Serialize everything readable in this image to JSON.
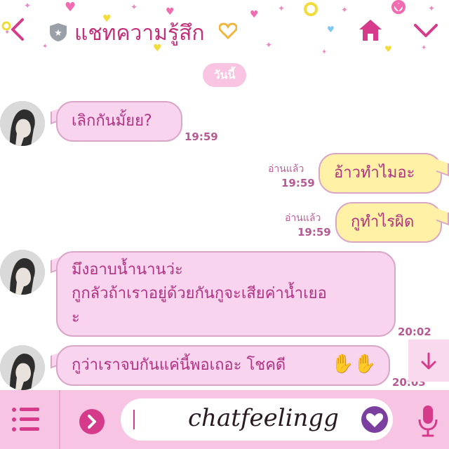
{
  "header": {
    "title": "แชทความรู้สึก"
  },
  "date_label": "วันนี้",
  "messages": [
    {
      "side": "in",
      "text_lines": [
        "เลิกกันมั้ยย?"
      ],
      "time": "19:59"
    },
    {
      "side": "out",
      "text_lines": [
        "อ้าวทำไมอะ"
      ],
      "read": "อ่านแล้ว",
      "time": "19:59"
    },
    {
      "side": "out",
      "text_lines": [
        "กูทำไรผิด"
      ],
      "read": "อ่านแล้ว",
      "time": "19:59"
    },
    {
      "side": "in",
      "text_lines": [
        "มึงอาบน้ำนานว่ะ",
        "กูกลัวถ้าเราอยู่ด้วยกันกูจะเสียค่าน้ำเยอ",
        "ะ"
      ],
      "time": "20:02"
    },
    {
      "side": "in",
      "text_lines": [
        "กูว่าเราจบกันแค่นี้พอเถอะ โชคดี"
      ],
      "time": "20:03"
    }
  ],
  "composer": {
    "watermark": "chatfeelingg"
  },
  "colors": {
    "accent": "#d63a8a",
    "incoming_bubble": "#f9d4ee",
    "outgoing_bubble": "#fff2a6",
    "bottom_bar": "#f7c5e3",
    "heart_purple": "#7b3fa0"
  }
}
